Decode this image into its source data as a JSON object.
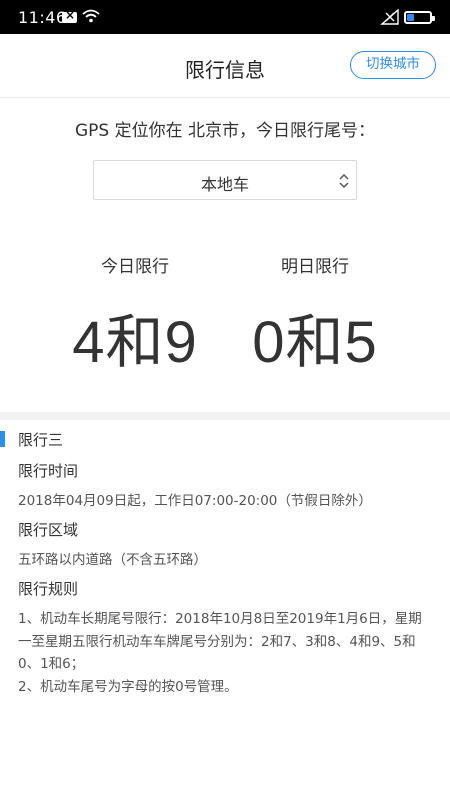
{
  "status_bar": {
    "time": "11:46"
  },
  "header": {
    "title": "限行信息",
    "switch_city_label": "切换城市"
  },
  "gps_text": "GPS 定位你在 北京市，今日限行尾号：",
  "car_type_select": {
    "selected": "本地车"
  },
  "limits": {
    "today_label": "今日限行",
    "today_numbers": "4和9",
    "tomorrow_label": "明日限行",
    "tomorrow_numbers": "0和5"
  },
  "section": {
    "title": "限行三",
    "time_title": "限行时间",
    "time_text": "2018年04月09日起，工作日07:00-20:00（节假日除外）",
    "area_title": "限行区域",
    "area_text": "五环路以内道路（不含五环路）",
    "rules_title": "限行规则",
    "rule_1_line_1": "1、机动车长期尾号限行：2018年10月8日至2019年1月6日，星期",
    "rule_1_line_2": "一至星期五限行机动车车牌尾号分别为：2和7、3和8、4和9、5和",
    "rule_1_line_3": "0、1和6；",
    "rule_2": "2、机动车尾号为字母的按0号管理。"
  },
  "colors": {
    "accent": "#2f8ee6",
    "status_bar_bg": "#000000",
    "text": "#333333"
  }
}
